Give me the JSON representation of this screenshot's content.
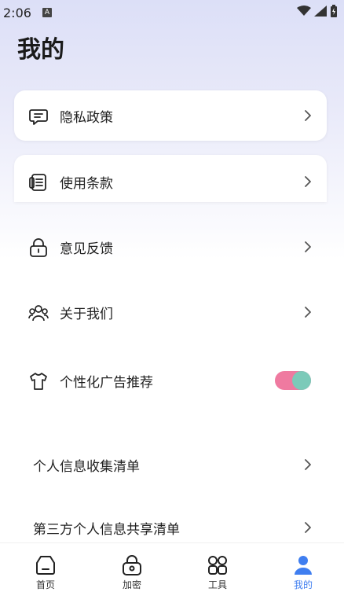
{
  "status_bar": {
    "time": "2:06",
    "notification_letter": "A"
  },
  "header": {
    "title": "我的"
  },
  "menu": {
    "privacy_policy": "隐私政策",
    "terms_of_use": "使用条款",
    "feedback": "意见反馈",
    "about_us": "关于我们",
    "personalized_ads": "个性化广告推荐",
    "personal_info_list": "个人信息收集清单",
    "third_party_list": "第三方个人信息共享清单"
  },
  "personalized_ads_enabled": true,
  "tabs": [
    {
      "label": "首页",
      "icon": "home-icon",
      "active": false
    },
    {
      "label": "加密",
      "icon": "lock-icon",
      "active": false
    },
    {
      "label": "工具",
      "icon": "tools-icon",
      "active": false
    },
    {
      "label": "我的",
      "icon": "user-icon",
      "active": true
    }
  ],
  "colors": {
    "accent": "#3f7ef0",
    "toggle_track": "#ef7aa0",
    "toggle_knob": "#7ccab9"
  }
}
